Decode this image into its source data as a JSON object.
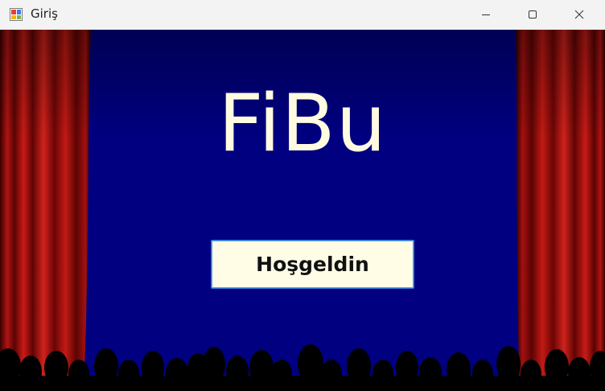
{
  "window": {
    "title": "Giriş",
    "icon": "windows-form-app-icon",
    "controls": [
      "minimize-icon",
      "maximize-icon",
      "close-icon"
    ]
  },
  "main": {
    "logo_text": "FiBu",
    "welcome_button_label": "Hoşgeldin"
  },
  "colors": {
    "stage_background": "#000080",
    "logo_text": "#fffbe0",
    "button_background": "#fffde6",
    "button_border": "#2f7bd6",
    "curtain": "#9e1010",
    "audience_silhouette": "#000000"
  }
}
